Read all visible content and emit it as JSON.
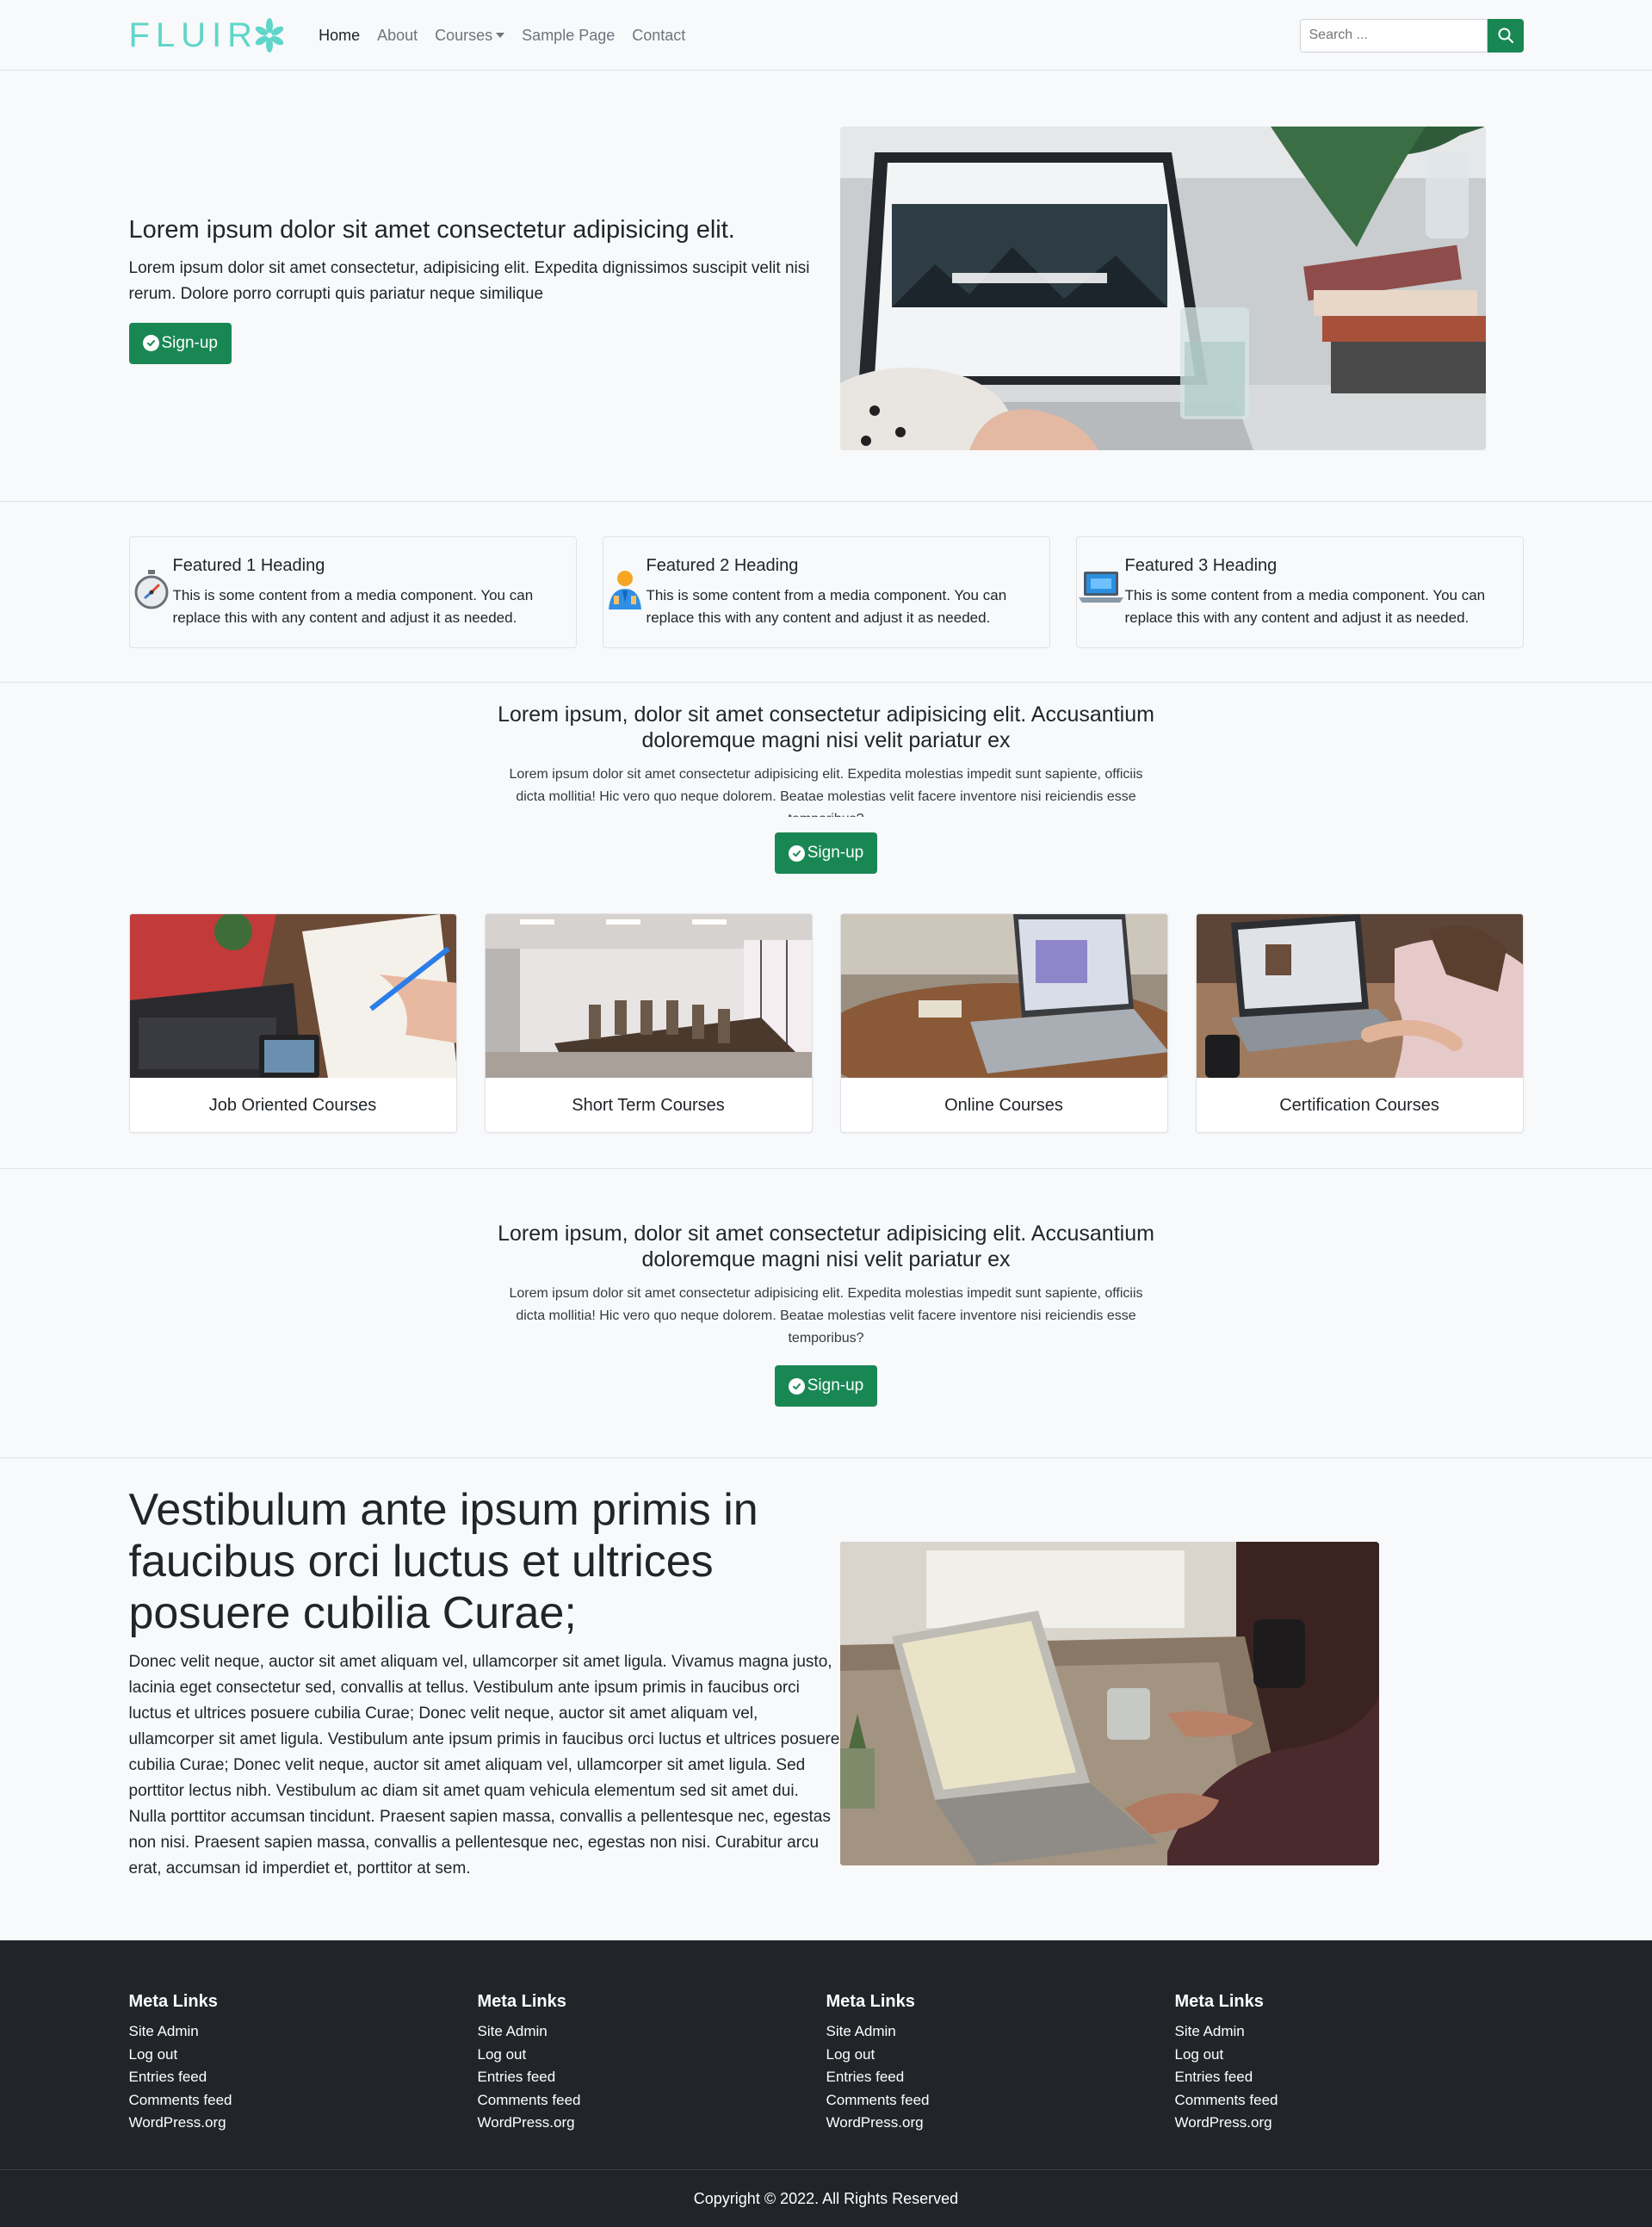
{
  "brand": {
    "logo_text": "FLUIR",
    "accent": "#5fd6c8",
    "primary_green": "#198754"
  },
  "nav": {
    "items": [
      {
        "label": "Home",
        "active": true
      },
      {
        "label": "About"
      },
      {
        "label": "Courses"
      },
      {
        "label": "Sample Page"
      },
      {
        "label": "Contact"
      }
    ]
  },
  "search": {
    "placeholder": "Search ...",
    "icon": "search-icon"
  },
  "hero": {
    "title": "Lorem ipsum dolor sit amet consectetur adipisicing elit.",
    "text": "Lorem ipsum dolor sit amet consectetur, adipisicing elit. Expedita dignissimos suscipit velit nisi rerum. Dolore porro corrupti quis pariatur neque similique",
    "button": "Sign-up"
  },
  "features": [
    {
      "title": "Featured 1 Heading",
      "text": "This is some content from a media component. You can replace this with any content and adjust it as needed.",
      "icon": "stopwatch-icon"
    },
    {
      "title": "Featured  2 Heading",
      "text": "This is some content from a media component. You can replace this with any content and adjust it as needed.",
      "icon": "user-icon"
    },
    {
      "title": "Featured 3 Heading",
      "text": "This is some content from a media component. You can replace this with any content and adjust it as needed.",
      "icon": "laptop-icon"
    }
  ],
  "cta1": {
    "title": "Lorem ipsum, dolor sit amet consectetur adipisicing elit. Accusantium doloremque magni nisi velit pariatur ex",
    "text": "Lorem ipsum dolor sit amet consectetur adipisicing elit. Expedita molestias impedit sunt sapiente, officiis dicta mollitia! Hic vero quo neque dolorem. Beatae molestias velit facere inventore nisi reiciendis esse temporibus?",
    "button": "Sign-up"
  },
  "courses": [
    {
      "title": "Job Oriented Courses"
    },
    {
      "title": "Short Term Courses"
    },
    {
      "title": "Online Courses"
    },
    {
      "title": "Certification Courses"
    }
  ],
  "cta2": {
    "title": "Lorem ipsum, dolor sit amet consectetur adipisicing elit. Accusantium doloremque magni nisi velit pariatur ex",
    "text": "Lorem ipsum dolor sit amet consectetur adipisicing elit. Expedita molestias impedit sunt sapiente, officiis dicta mollitia! Hic vero quo neque dolorem. Beatae molestias velit facere inventore nisi reiciendis esse temporibus?",
    "button": "Sign-up"
  },
  "article": {
    "title": "Vestibulum ante ipsum primis in faucibus orci luctus et ultrices posuere cubilia Curae;",
    "text": "Donec velit neque, auctor sit amet aliquam vel, ullamcorper sit amet ligula. Vivamus magna justo, lacinia eget consectetur sed, convallis at tellus. Vestibulum ante ipsum primis in faucibus orci luctus et ultrices posuere cubilia Curae; Donec velit neque, auctor sit amet aliquam vel, ullamcorper sit amet ligula. Vestibulum ante ipsum primis in faucibus orci luctus et ultrices posuere cubilia Curae; Donec velit neque, auctor sit amet aliquam vel, ullamcorper sit amet ligula. Sed porttitor lectus nibh. Vestibulum ac diam sit amet quam vehicula elementum sed sit amet dui. Nulla porttitor accumsan tincidunt. Praesent sapien massa, convallis a pellentesque nec, egestas non nisi. Praesent sapien massa, convallis a pellentesque nec, egestas non nisi. Curabitur arcu erat, accumsan id imperdiet et, porttitor at sem."
  },
  "footer": {
    "columns": [
      {
        "title": "Meta Links",
        "links": [
          "Site Admin",
          "Log out",
          "Entries feed",
          "Comments feed",
          "WordPress.org"
        ]
      },
      {
        "title": "Meta Links",
        "links": [
          "Site Admin",
          "Log out",
          "Entries feed",
          "Comments feed",
          "WordPress.org"
        ]
      },
      {
        "title": "Meta Links",
        "links": [
          "Site Admin",
          "Log out",
          "Entries feed",
          "Comments feed",
          "WordPress.org"
        ]
      },
      {
        "title": "Meta Links",
        "links": [
          "Site Admin",
          "Log out",
          "Entries feed",
          "Comments feed",
          "WordPress.org"
        ]
      }
    ],
    "copyright": "Copyright © 2022. All Rights Reserved"
  }
}
